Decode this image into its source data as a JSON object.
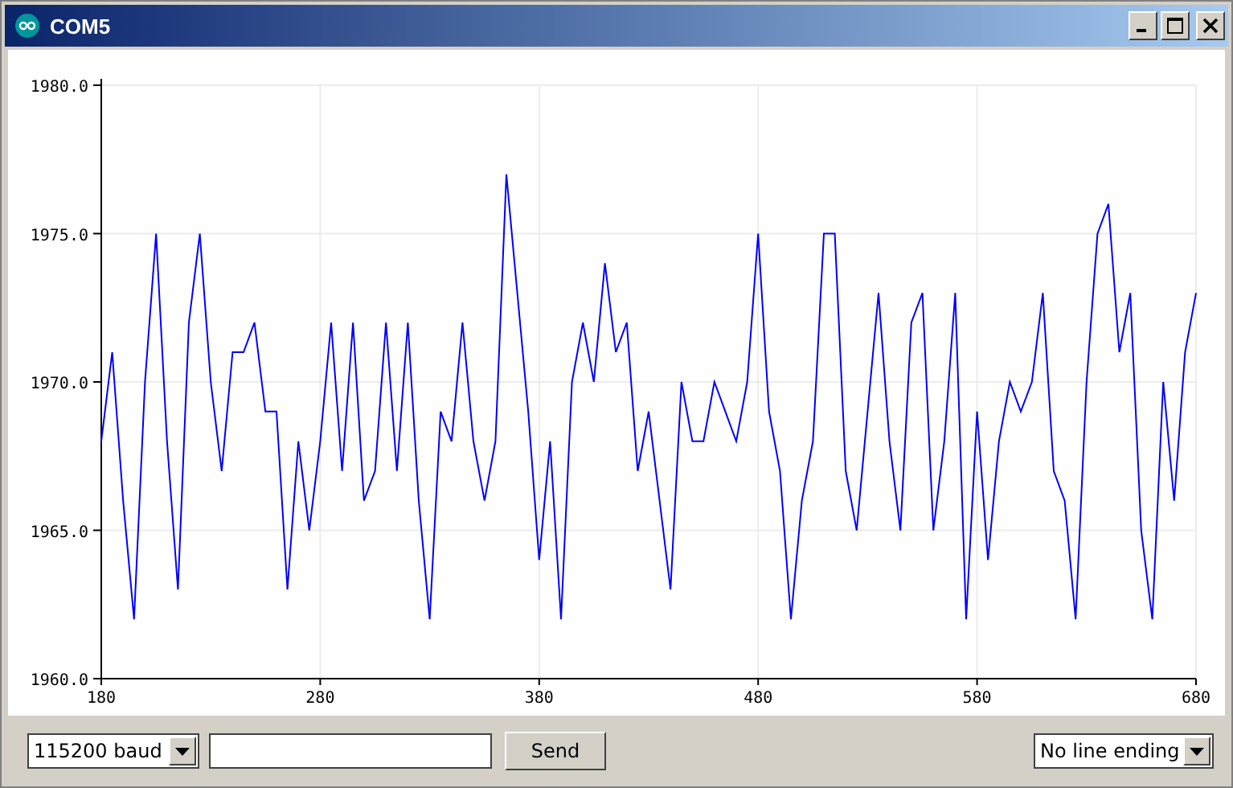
{
  "window": {
    "title": "COM5"
  },
  "plot": {
    "chart_data": {
      "type": "line",
      "x": [
        180,
        185,
        190,
        195,
        200,
        205,
        210,
        215,
        220,
        225,
        230,
        235,
        240,
        245,
        250,
        255,
        260,
        265,
        270,
        275,
        280,
        285,
        290,
        295,
        300,
        305,
        310,
        315,
        320,
        325,
        330,
        335,
        340,
        345,
        350,
        355,
        360,
        365,
        370,
        375,
        380,
        385,
        390,
        395,
        400,
        405,
        410,
        415,
        420,
        425,
        430,
        435,
        440,
        445,
        450,
        455,
        460,
        465,
        470,
        475,
        480,
        485,
        490,
        495,
        500,
        505,
        510,
        515,
        520,
        525,
        530,
        535,
        540,
        545,
        550,
        555,
        560,
        565,
        570,
        575,
        580,
        585,
        590,
        595,
        600,
        605,
        610,
        615,
        620,
        625,
        630,
        635,
        640,
        645,
        650,
        655,
        660,
        665,
        670,
        675,
        680
      ],
      "series": [
        {
          "color": "#0000ff",
          "values": [
            1968,
            1971,
            1966,
            1962,
            1970,
            1975,
            1968,
            1963,
            1972,
            1975,
            1970,
            1967,
            1971,
            1971,
            1972,
            1969,
            1969,
            1963,
            1968,
            1965,
            1968,
            1972,
            1967,
            1972,
            1966,
            1967,
            1972,
            1967,
            1972,
            1966,
            1962,
            1969,
            1968,
            1972,
            1968,
            1966,
            1968,
            1977,
            1973,
            1969,
            1964,
            1968,
            1962,
            1970,
            1972,
            1970,
            1974,
            1971,
            1972,
            1967,
            1969,
            1966,
            1963,
            1970,
            1968,
            1968,
            1970,
            1969,
            1968,
            1970,
            1975,
            1969,
            1967,
            1962,
            1966,
            1968,
            1975,
            1975,
            1967,
            1965,
            1969,
            1973,
            1968,
            1965,
            1972,
            1973,
            1965,
            1968,
            1973,
            1962,
            1969,
            1964,
            1968,
            1970,
            1969,
            1970,
            1973,
            1967,
            1966,
            1962,
            1970,
            1975,
            1976,
            1971,
            1973,
            1965,
            1962,
            1970,
            1966,
            1971,
            1973
          ]
        }
      ],
      "grid": true,
      "xlim": [
        180,
        680
      ],
      "ylim": [
        1960,
        1980
      ],
      "xticks": [
        180,
        280,
        380,
        480,
        580,
        680
      ],
      "yticks": [
        {
          "value": 1960,
          "label": "1960.0"
        },
        {
          "value": 1965,
          "label": "1965.0"
        },
        {
          "value": 1970,
          "label": "1970.0"
        },
        {
          "value": 1975,
          "label": "1975.0"
        },
        {
          "value": 1980,
          "label": "1980.0"
        }
      ]
    }
  },
  "controls": {
    "baud": {
      "value": "115200 baud"
    },
    "send_button": "Send",
    "line_ending": {
      "value": "No line ending"
    }
  }
}
